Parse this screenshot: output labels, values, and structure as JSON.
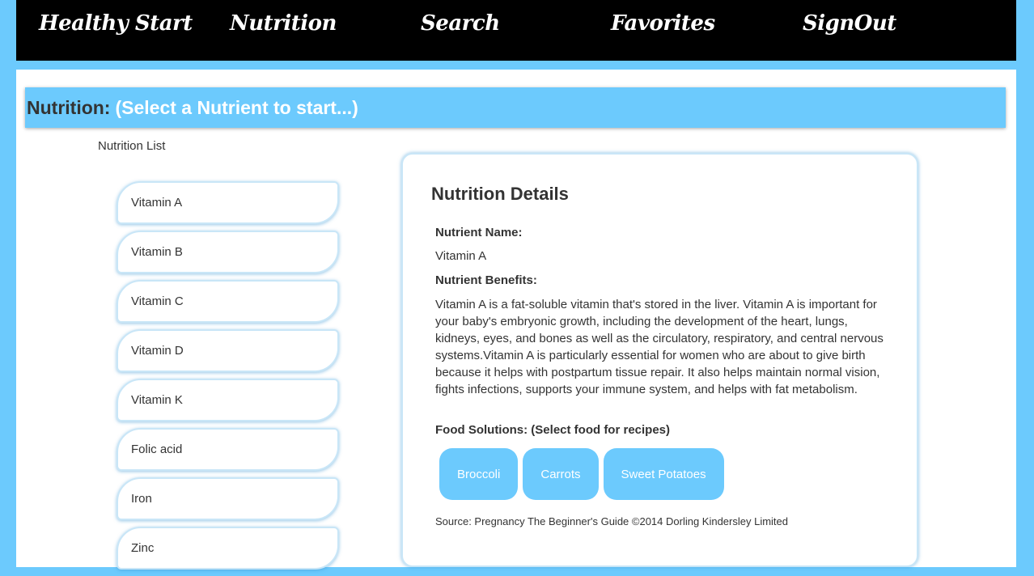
{
  "nav": {
    "items": [
      {
        "label": "Healthy Start"
      },
      {
        "label": "Nutrition"
      },
      {
        "label": "Search"
      },
      {
        "label": "Favorites"
      },
      {
        "label": "SignOut"
      }
    ]
  },
  "page": {
    "title_label": "Nutrition:",
    "title_hint": "(Select a Nutrient to start...)"
  },
  "nutrient_list": {
    "heading": "Nutrition List",
    "items": [
      {
        "label": "Vitamin A"
      },
      {
        "label": "Vitamin B"
      },
      {
        "label": "Vitamin C"
      },
      {
        "label": "Vitamin D"
      },
      {
        "label": "Vitamin K"
      },
      {
        "label": "Folic acid"
      },
      {
        "label": "Iron"
      },
      {
        "label": "Zinc"
      }
    ]
  },
  "details": {
    "heading": "Nutrition Details",
    "name_label": "Nutrient Name:",
    "name_value": "Vitamin A",
    "benefits_label": "Nutrient Benefits:",
    "benefits_text": "Vitamin A is a fat-soluble vitamin that's stored in the liver. Vitamin A is important for your baby's embryonic growth, including the development of the heart, lungs, kidneys, eyes, and bones as well as the circulatory, respiratory, and central nervous systems.Vitamin A is particularly essential for women who are about to give birth because it helps with postpartum tissue repair. It also helps maintain normal vision, fights infections, supports your immune system, and helps with fat metabolism.",
    "food_label": "Food Solutions: (Select food for recipes)",
    "foods": [
      {
        "label": "Broccoli"
      },
      {
        "label": "Carrots"
      },
      {
        "label": "Sweet Potatoes"
      }
    ],
    "source": "Source: Pregnancy The Beginner's Guide ©2014 Dorling Kindersley Limited"
  },
  "colors": {
    "accent": "#6ccafd",
    "nav_background": "#000000",
    "panel_background": "#ffffff"
  }
}
